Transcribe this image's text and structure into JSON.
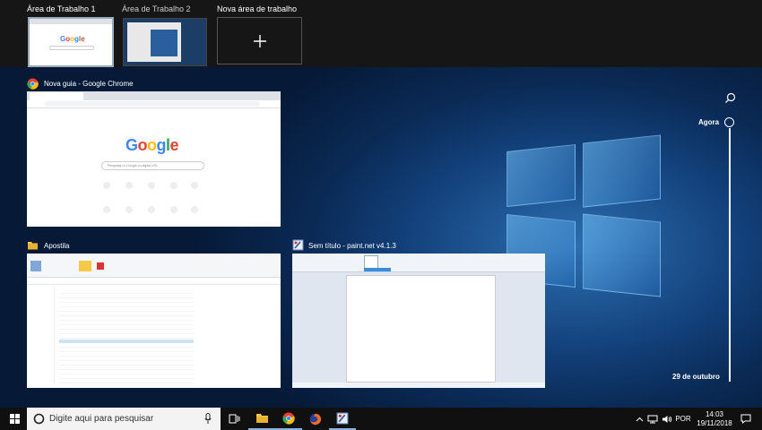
{
  "desktops": {
    "items": [
      {
        "label": "Área de Trabalho 1",
        "active": true
      },
      {
        "label": "Área de Trabalho 2",
        "active": false
      }
    ],
    "new_label": "Nova área de trabalho",
    "new_icon": "plus-icon"
  },
  "windows": [
    {
      "title": "Nova guia - Google Chrome",
      "app_icon": "chrome-icon",
      "search_placeholder": "Pesquisar no Google ou digitar URL",
      "logo": "Google"
    },
    {
      "title": "Apostila",
      "app_icon": "folder-icon"
    },
    {
      "title": "Sem título - paint.net v4.1.3",
      "app_icon": "paintnet-icon"
    }
  ],
  "timeline": {
    "now_label": "Agora",
    "date_label": "29 de outubro",
    "search_icon": "search-icon"
  },
  "taskbar": {
    "search_placeholder": "Digite aqui para pesquisar",
    "language": "POR",
    "time": "14:03",
    "date": "19/11/2018"
  },
  "colors": {
    "accent": "#3b8edb",
    "taskbar": "#101010",
    "google_blue": "#4285F4",
    "google_red": "#EA4335",
    "google_yellow": "#FBBC05",
    "google_green": "#34A853"
  }
}
